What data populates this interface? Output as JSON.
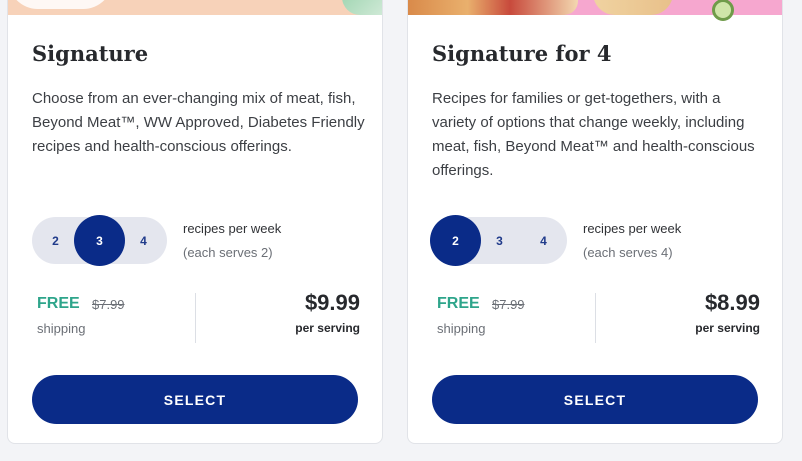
{
  "plans": [
    {
      "title": "Signature",
      "description": "Choose from an ever-changing mix of meat, fish, Beyond Meat™, WW Approved, Diabetes Friendly recipes and health-conscious offerings.",
      "recipe_options": [
        "2",
        "3",
        "4"
      ],
      "selected_option": "3",
      "recipes_label": "recipes per week",
      "serves_label": "(each serves 2)",
      "shipping_free": "FREE",
      "shipping_original": "$7.99",
      "shipping_label": "shipping",
      "price": "$9.99",
      "price_unit": "per serving",
      "button_label": "SELECT"
    },
    {
      "title": "Signature for 4",
      "description": "Recipes for families or get-togethers, with a variety of options that change weekly, including meat, fish, Beyond Meat™ and health-conscious offerings.",
      "recipe_options": [
        "2",
        "3",
        "4"
      ],
      "selected_option": "2",
      "recipes_label": "recipes per week",
      "serves_label": "(each serves 4)",
      "shipping_free": "FREE",
      "shipping_original": "$7.99",
      "shipping_label": "shipping",
      "price": "$8.99",
      "price_unit": "per serving",
      "button_label": "SELECT"
    }
  ],
  "colors": {
    "primary": "#0a2b88",
    "free_accent": "#2ea58b",
    "picker_bg": "#e4e6ee",
    "page_bg": "#f3f4f7"
  }
}
